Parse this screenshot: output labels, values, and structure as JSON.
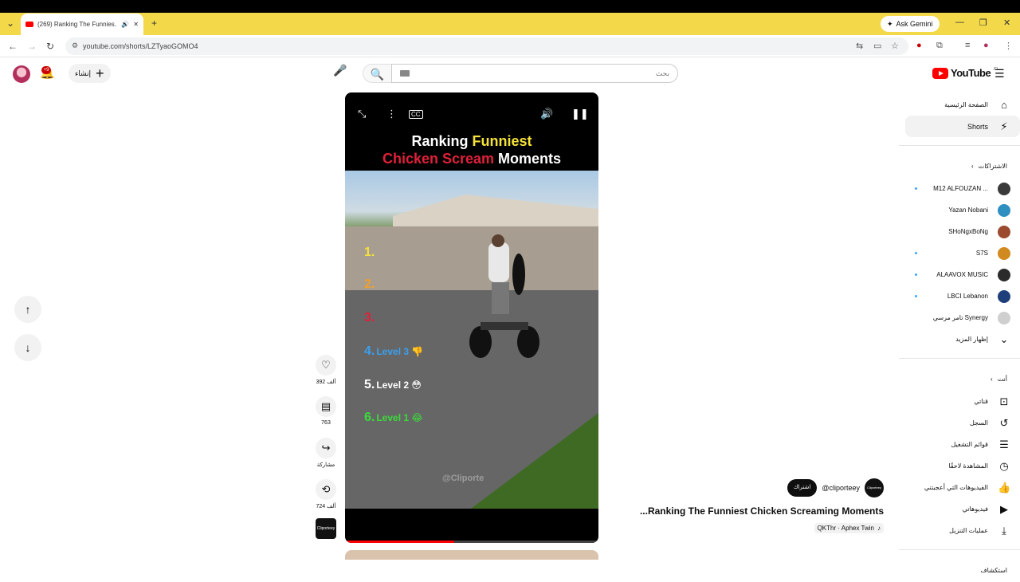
{
  "browser": {
    "tab_title": "(269) Ranking The Funnies…",
    "new_tab": "+",
    "gemini_label": "Ask Gemini",
    "url": "youtube.com/shorts/LZTyaoGOMO4"
  },
  "header": {
    "notif_count": "+9",
    "create_label": "إنشاء",
    "search_placeholder": "بحث",
    "logo_text": "YouTube",
    "logo_region": "JO"
  },
  "sidebar": {
    "home": "الصفحة الرئيسية",
    "shorts": "Shorts",
    "subs_heading": "الاشتراكات",
    "channels": [
      {
        "name": "M12 ALFOUZAN ...",
        "color": "#3a3a3a"
      },
      {
        "name": "Yazan Nobani",
        "color": "#2f8fc0"
      },
      {
        "name": "SHoNgxBoNg",
        "color": "#9c4a2f"
      },
      {
        "name": "S7S",
        "color": "#d08a1f"
      },
      {
        "name": "ALAAVOX MUSIC",
        "color": "#2b2b2b"
      },
      {
        "name": "LBCI Lebanon",
        "color": "#1f3f7a"
      },
      {
        "name": "تامر مرسي Synergy",
        "color": "#cfcfcf"
      }
    ],
    "show_more": "إظهار المزيد",
    "you_heading": "أنت",
    "you_items": [
      "قناتي",
      "السجل",
      "قوائم التشغيل",
      "المشاهدة لاحقًا",
      "الفيديوهات التي أعجبتني",
      "فيديوهاتي",
      "عمليات التنزيل"
    ],
    "explore_heading": "استكشاف"
  },
  "video": {
    "title_line1_a": "Ranking ",
    "title_line1_b": "Funniest",
    "title_line2_a": "Chicken Scream ",
    "title_line2_b": "Moments",
    "ranks": [
      {
        "num": "1.",
        "label": "",
        "color": "#f4e23a"
      },
      {
        "num": "2.",
        "label": "",
        "color": "#f0a030"
      },
      {
        "num": "3.",
        "label": "",
        "color": "#e0203a"
      },
      {
        "num": "4.",
        "label": "Level 3 👎",
        "color": "#3aa0f0"
      },
      {
        "num": "5.",
        "label": "Level 2 😳",
        "color": "#ffffff"
      },
      {
        "num": "6.",
        "label": "Level 1 😂",
        "color": "#3adc3a"
      }
    ],
    "watermark": "@Cliporte",
    "progress": 0.43
  },
  "actions": {
    "likes": "392 ألف",
    "comments": "763",
    "share": "مشاركة",
    "remix": "724 ألف",
    "channel_thumb": "Cliporteey"
  },
  "meta": {
    "subscribe": "اشتراك",
    "handle": "@cliporteey",
    "title": "...Ranking The Funniest Chicken Screaming Moments",
    "song": "QKThr · Aphex Twin"
  }
}
